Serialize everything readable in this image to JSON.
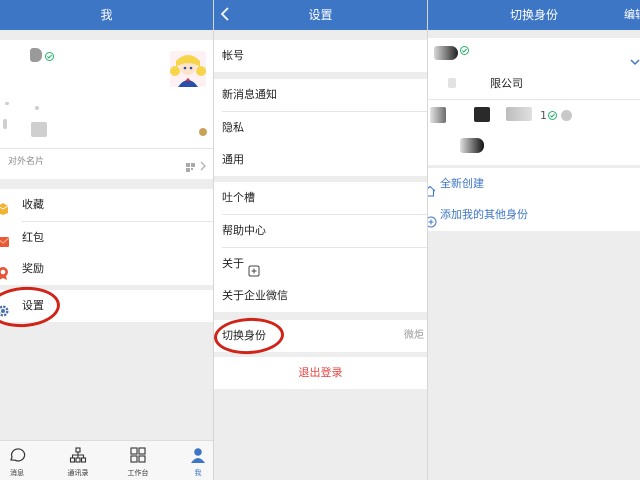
{
  "panel_me": {
    "title": "我",
    "card_label": "对外名片",
    "menu": [
      {
        "label": "收藏",
        "icon": "favorites-icon"
      },
      {
        "label": "红包",
        "icon": "red-packet-icon"
      },
      {
        "label": "奖励",
        "icon": "reward-icon"
      },
      {
        "label": "设置",
        "icon": "settings-gear-icon"
      }
    ],
    "tabs": [
      {
        "label": "消息",
        "icon": "message-icon"
      },
      {
        "label": "通讯录",
        "icon": "contacts-icon"
      },
      {
        "label": "工作台",
        "icon": "workbench-icon"
      },
      {
        "label": "我",
        "icon": "me-icon"
      }
    ]
  },
  "panel_settings": {
    "title": "设置",
    "items": {
      "account": "帐号",
      "notification": "新消息通知",
      "privacy": "隐私",
      "general": "通用",
      "feedback": "吐个槽",
      "help": "帮助中心",
      "about": "关于",
      "about_wework": "关于企业微信",
      "switch_identity": "切换身份",
      "switch_identity_value": "微炬"
    },
    "logout": "退出登录"
  },
  "panel_switch": {
    "title": "切换身份",
    "edit": "编辑",
    "company_suffix": "限公司",
    "badge_number": "1",
    "create": "全新创建",
    "add_identity": "添加我的其他身份"
  },
  "colors": {
    "brand": "#3e76c6",
    "highlight_ring": "#d02418",
    "logout_red": "#e64340"
  }
}
